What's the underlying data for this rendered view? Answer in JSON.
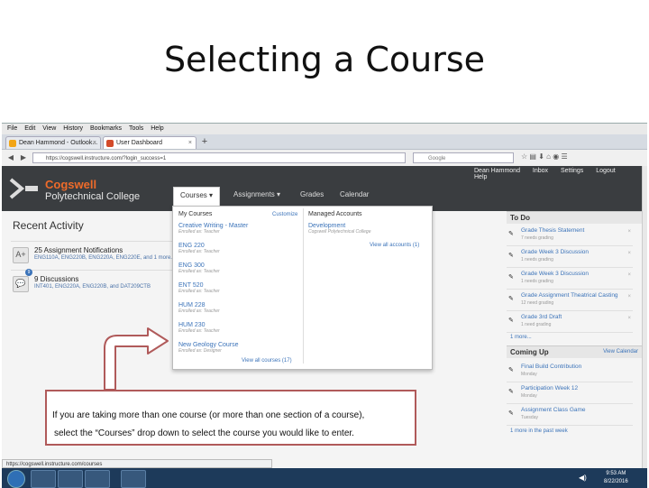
{
  "slide": {
    "title": "Selecting a Course",
    "callout_line1": "If you are taking more than one course (or more than one section of a course),",
    "callout_line2": "select the “Courses” drop down  to select the course you would like to enter."
  },
  "browser": {
    "menu": [
      "File",
      "Edit",
      "View",
      "History",
      "Bookmarks",
      "Tools",
      "Help"
    ],
    "tabs": [
      "Dean Hammond - Outlook...",
      "User Dashboard"
    ],
    "url": "https://cogswell.instructure.com/?login_success=1",
    "search_placeholder": "Google",
    "status_url": "https://cogswell.instructure.com/courses"
  },
  "canvas": {
    "logo_name": "Cogswell",
    "logo_sub": "Polytechnical College",
    "top_links": [
      "Dean Hammond",
      "Inbox",
      "Settings",
      "Logout",
      "Help"
    ],
    "nav": [
      "Courses",
      "Assignments",
      "Grades",
      "Calendar"
    ],
    "recent_title": "Recent Activity",
    "activities": [
      {
        "title": "25 Assignment Notifications",
        "sub": "ENG110A, ENG220B, ENG220A, ENG220E, and 1 more...",
        "icon": "A+"
      },
      {
        "title": "9 Discussions",
        "sub": "INT401, ENG220A, ENG220B, and DAT209CTB",
        "icon": "",
        "badge": "9"
      }
    ]
  },
  "dropdown": {
    "my_courses": "My Courses",
    "customize": "Customize",
    "managed": "Managed Accounts",
    "courses": [
      {
        "name": "Creative Writing - Master",
        "enrolled": "Enrolled as: Teacher"
      },
      {
        "name": "ENG 220",
        "enrolled": "Enrolled as: Teacher"
      },
      {
        "name": "ENG 300",
        "enrolled": "Enrolled as: Teacher"
      },
      {
        "name": "ENT 520",
        "enrolled": "Enrolled as: Teacher"
      },
      {
        "name": "HUM 228",
        "enrolled": "Enrolled as: Teacher"
      },
      {
        "name": "HUM 230",
        "enrolled": "Enrolled as: Teacher"
      },
      {
        "name": "New Geology Course",
        "enrolled": "Enrolled as: Designer"
      }
    ],
    "account_name": "Development",
    "account_sub": "Cogswell Polytechnical College",
    "view_all_accounts": "View all accounts (1)",
    "view_all_courses": "View all courses (17)"
  },
  "todo": {
    "title": "To Do",
    "items": [
      {
        "title": "Grade Thesis Statement",
        "sub": "7 needs grading"
      },
      {
        "title": "Grade Week 3 Discussion",
        "sub": "1 needs grading"
      },
      {
        "title": "Grade Week 3 Discussion",
        "sub": "1 needs grading"
      },
      {
        "title": "Grade Assignment Theatrical Casting",
        "sub": "12 need grading"
      },
      {
        "title": "Grade 3rd Draft",
        "sub": "1 need grading"
      }
    ],
    "more": "1 more...",
    "coming_title": "Coming Up",
    "view_calendar": "View Calendar",
    "coming": [
      {
        "title": "Final Build Contribution",
        "sub": "Monday"
      },
      {
        "title": "Participation Week 12",
        "sub": "Monday"
      },
      {
        "title": "Assignment Class Game",
        "sub": "Tuesday"
      }
    ],
    "more_past": "1 more in the past week"
  },
  "taskbar": {
    "time": "9:53 AM",
    "date": "8/22/2016"
  },
  "colors": {
    "brand_orange": "#ee6b2a",
    "link_blue": "#3b73b9",
    "canvas_header": "#3a3d40",
    "callout_border": "#b05a5a"
  }
}
